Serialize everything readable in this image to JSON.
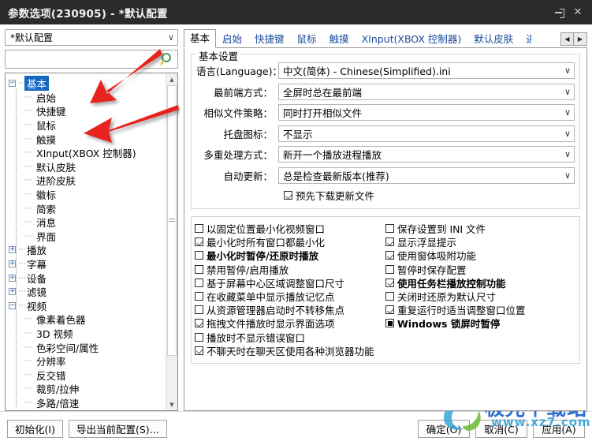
{
  "window": {
    "title": "参数选项(230905) - *默认配置",
    "pin_icon": "pin-icon",
    "close_label": "✕"
  },
  "sidebar": {
    "profile_combo": {
      "value": "*默认配置",
      "arrow": "∨"
    },
    "search": {
      "value": "",
      "placeholder": "",
      "icon": "search-icon"
    },
    "tree": [
      {
        "label": "基本",
        "level": 0,
        "expander": "−",
        "selected": true
      },
      {
        "label": "启始",
        "level": 1
      },
      {
        "label": "快捷键",
        "level": 1
      },
      {
        "label": "鼠标",
        "level": 1
      },
      {
        "label": "触摸",
        "level": 1
      },
      {
        "label": "XInput(XBOX 控制器)",
        "level": 1
      },
      {
        "label": "默认皮肤",
        "level": 1
      },
      {
        "label": "进阶皮肤",
        "level": 1
      },
      {
        "label": "徽标",
        "level": 1
      },
      {
        "label": "简索",
        "level": 1
      },
      {
        "label": "消息",
        "level": 1
      },
      {
        "label": "界面",
        "level": 1
      },
      {
        "label": "播放",
        "level": 0,
        "expander": "+"
      },
      {
        "label": "字幕",
        "level": 0,
        "expander": "+"
      },
      {
        "label": "设备",
        "level": 0,
        "expander": "+"
      },
      {
        "label": "滤镜",
        "level": 0,
        "expander": "+"
      },
      {
        "label": "视频",
        "level": 0,
        "expander": "−"
      },
      {
        "label": "像素着色器",
        "level": 1
      },
      {
        "label": "3D 视频",
        "level": 1
      },
      {
        "label": "色彩空间/属性",
        "level": 1
      },
      {
        "label": "分辨率",
        "level": 1
      },
      {
        "label": "反交错",
        "level": 1
      },
      {
        "label": "裁剪/拉伸",
        "level": 1
      },
      {
        "label": "多路/倍速",
        "level": 1
      }
    ],
    "scroll_up": "▲",
    "scroll_down": "▼"
  },
  "tabs": {
    "items": [
      {
        "label": "基本",
        "active": true
      },
      {
        "label": "启始",
        "active": false
      },
      {
        "label": "快捷键",
        "active": false
      },
      {
        "label": "鼠标",
        "active": false
      },
      {
        "label": "触摸",
        "active": false
      },
      {
        "label": "XInput(XBOX 控制器)",
        "active": false
      },
      {
        "label": "默认皮肤",
        "active": false
      },
      {
        "label": "进",
        "active": false
      }
    ],
    "nav_prev": "◀",
    "nav_next": "▶"
  },
  "settings_group": {
    "legend": "基本设置",
    "fields": [
      {
        "label": "语言(Language)：",
        "value": "中文(简体) - Chinese(Simplified).ini",
        "arrow": "∨"
      },
      {
        "label": "最前端方式：",
        "value": "全屏时总在最前端",
        "arrow": "∨"
      },
      {
        "label": "相似文件策略：",
        "value": "同时打开相似文件",
        "arrow": "∨"
      },
      {
        "label": "托盘图标：",
        "value": "不显示",
        "arrow": "∨"
      },
      {
        "label": "多重处理方式：",
        "value": "新开一个播放进程播放",
        "arrow": "∨"
      },
      {
        "label": "自动更新：",
        "value": "总是检查最新版本(推荐)",
        "arrow": "∨"
      }
    ],
    "inline_check": {
      "label": "预先下载更新文件",
      "state": "checked",
      "bold": false
    }
  },
  "checkbox_grid": {
    "left_column": [
      {
        "label": "以固定位置最小化视频窗口",
        "state": "unchecked",
        "bold": false
      },
      {
        "label": "最小化时所有窗口都最小化",
        "state": "checked",
        "bold": false
      },
      {
        "label": "最小化时暂停/还原时播放",
        "state": "unchecked",
        "bold": true
      },
      {
        "label": "禁用暂停/启用播放",
        "state": "unchecked",
        "bold": false
      },
      {
        "label": "基于屏幕中心区域调整窗口尺寸",
        "state": "unchecked",
        "bold": false
      },
      {
        "label": "在收藏菜单中显示播放记忆点",
        "state": "unchecked",
        "bold": false
      },
      {
        "label": "从资源管理器启动时不转移焦点",
        "state": "unchecked",
        "bold": false
      },
      {
        "label": "拖拽文件播放时显示界面选项",
        "state": "checked",
        "bold": false
      },
      {
        "label": "播放时不显示错误窗口",
        "state": "unchecked",
        "bold": false
      },
      {
        "label": "不聊天时在聊天区使用各种浏览器功能",
        "state": "checked",
        "bold": false
      }
    ],
    "right_column": [
      {
        "label": "保存设置到 INI 文件",
        "state": "unchecked",
        "bold": false
      },
      {
        "label": "显示浮显提示",
        "state": "checked",
        "bold": false
      },
      {
        "label": "使用窗体吸附功能",
        "state": "checked",
        "bold": false
      },
      {
        "label": "暂停时保存配置",
        "state": "unchecked",
        "bold": false
      },
      {
        "label": "使用任务栏播放控制功能",
        "state": "checked",
        "bold": true
      },
      {
        "label": "关闭时还原为默认尺寸",
        "state": "unchecked",
        "bold": false
      },
      {
        "label": "重复运行时适当调整窗口位置",
        "state": "checked",
        "bold": false
      },
      {
        "label": "Windows 锁屏时暂停",
        "state": "filled",
        "bold": true
      }
    ]
  },
  "footer": {
    "init_button": "初始化(I)",
    "export_button": "导出当前配置(S)...",
    "ok_button": "确定(O)",
    "cancel_button": "取消(C)",
    "apply_button": "应用(A)"
  },
  "watermark": {
    "text": "极光下载站",
    "subtext": "www.xz7.com"
  },
  "colors": {
    "titlebar_bg": "#2b2b2b",
    "selection": "#1669c1",
    "tab_link": "#1a4b9c",
    "annotation_arrow": "#e8231a",
    "watermark": "#2e6fd0"
  }
}
